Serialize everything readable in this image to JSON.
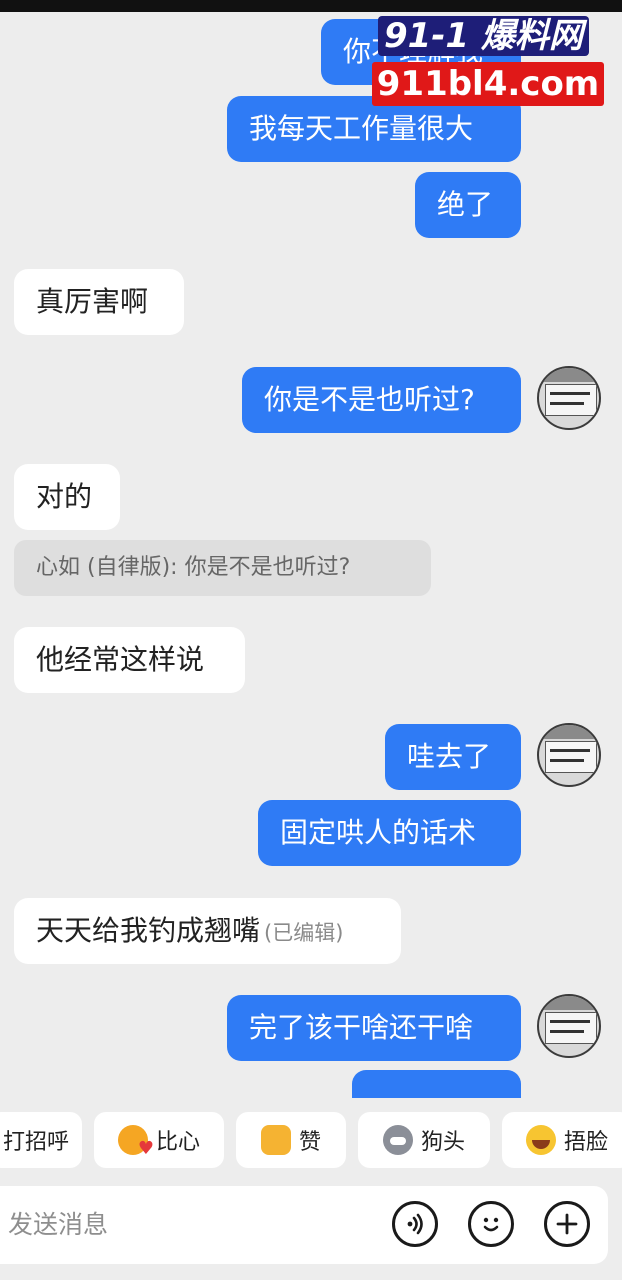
{
  "watermark": {
    "line1": "91-1 爆料网",
    "line2": "911bl4.com"
  },
  "messages": [
    {
      "text": "你不理解我"
    },
    {
      "text": "我每天工作量很大"
    },
    {
      "text": "绝了"
    },
    {
      "text": "真厉害啊"
    },
    {
      "text": "你是不是也听过?"
    },
    {
      "text": "对的"
    },
    {
      "quote": "心如 (自律版): 你是不是也听过?"
    },
    {
      "text": "他经常这样说"
    },
    {
      "text": "哇去了"
    },
    {
      "text": "固定哄人的话术"
    },
    {
      "text": "天天给我钓成翘嘴",
      "edited": "(已编辑)"
    },
    {
      "text": "完了该干啥还干啥"
    },
    {
      "text": "…"
    }
  ],
  "reactions": [
    {
      "label": "打招呼"
    },
    {
      "label": "比心",
      "icon": "heart-hands-emoji"
    },
    {
      "label": "赞",
      "icon": "thumbs-up-emoji"
    },
    {
      "label": "狗头",
      "icon": "dog-head-emoji"
    },
    {
      "label": "捂脸",
      "icon": "facepalm-emoji"
    }
  ],
  "input": {
    "placeholder": "发送消息",
    "icons": [
      "voice-icon",
      "emoji-icon",
      "plus-icon"
    ]
  },
  "colors": {
    "background": "#ededed",
    "outgoing_bubble": "#2f7bf5",
    "incoming_bubble": "#ffffff",
    "watermark_red": "#e01818"
  }
}
